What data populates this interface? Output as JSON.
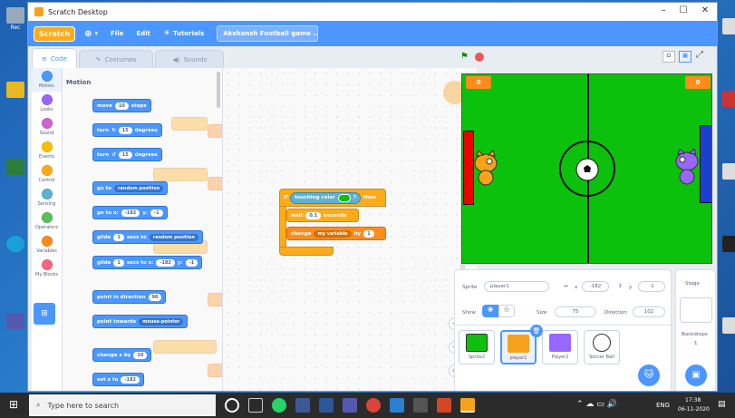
{
  "window": {
    "title": "Scratch Desktop"
  },
  "menu": {
    "logo": "Scratch",
    "file": "File",
    "edit": "Edit",
    "tutorials": "Tutorials",
    "project_title": "Akshansh Football game ..."
  },
  "tabs": {
    "code": "Code",
    "costumes": "Costumes",
    "sounds": "Sounds"
  },
  "categories": [
    "Motion",
    "Looks",
    "Sound",
    "Events",
    "Control",
    "Sensing",
    "Operators",
    "Variables",
    "My Blocks"
  ],
  "category_colors": [
    "#4c97ff",
    "#9966ff",
    "#cf63cf",
    "#ffbf00",
    "#ffab19",
    "#5cb1d6",
    "#59c059",
    "#ff8c1a",
    "#ff6680"
  ],
  "palette": {
    "title": "Motion",
    "move": {
      "a": "move",
      "v": "10",
      "b": "steps"
    },
    "turn_right": {
      "a": "turn",
      "v": "15",
      "b": "degrees"
    },
    "turn_left": {
      "a": "turn",
      "v": "15",
      "b": "degrees"
    },
    "goto": {
      "a": "go to",
      "dd": "random position"
    },
    "gotoxy": {
      "a": "go to x:",
      "x": "-182",
      "b": "y:",
      "y": "-1"
    },
    "glide_rand": {
      "a": "glide",
      "v": "1",
      "b": "secs to",
      "dd": "random position"
    },
    "glide_xy": {
      "a": "glide",
      "v": "1",
      "b": "secs to x:",
      "x": "-182",
      "c": "y:",
      "y": "-1"
    },
    "point_dir": {
      "a": "point in direction",
      "v": "90"
    },
    "point_towards": {
      "a": "point towards",
      "dd": "mouse-pointer"
    },
    "change_x": {
      "a": "change x by",
      "v": "10"
    },
    "set_x": {
      "a": "set x to",
      "v": "-182"
    }
  },
  "script": {
    "if": "if",
    "touching": "touching color",
    "q": "?",
    "then": "then",
    "wait": "wait",
    "wait_v": "0.1",
    "seconds": "seconds",
    "change": "change",
    "var": "my variable",
    "by": "by",
    "by_v": "1"
  },
  "stage": {
    "score_left": "0",
    "score_right": "0"
  },
  "sprite_info": {
    "sprite_label": "Sprite",
    "sprite_name": "player1",
    "x_label": "x",
    "x": "-182",
    "y_label": "y",
    "y": "-1",
    "show_label": "Show",
    "size_label": "Size",
    "size": "75",
    "direction_label": "Direction",
    "direction": "102"
  },
  "sprites": [
    {
      "name": "Sprite2"
    },
    {
      "name": "player1"
    },
    {
      "name": "Player2"
    },
    {
      "name": "Soccer Ball"
    }
  ],
  "stage_pane": {
    "title": "Stage",
    "backdrops_label": "Backdrops",
    "backdrops_count": "1"
  },
  "taskbar": {
    "search": "Type here to search",
    "lang": "ENG",
    "time": "17:38",
    "date": "06-11-2020"
  }
}
